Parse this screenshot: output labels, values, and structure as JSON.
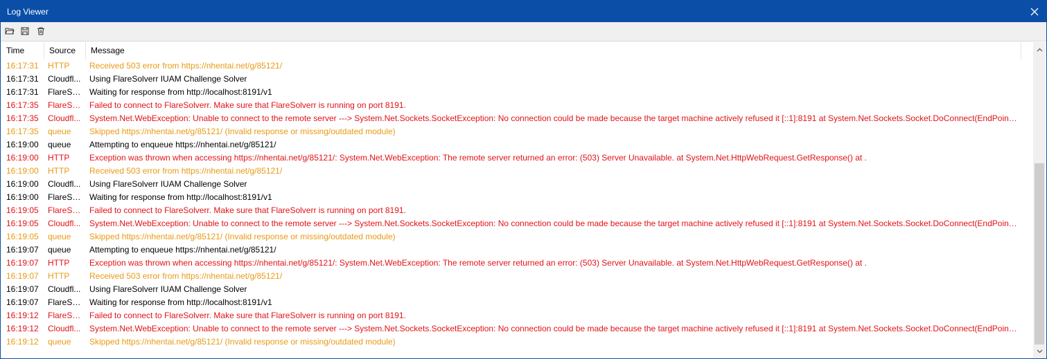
{
  "window": {
    "title": "Log Viewer",
    "close_icon": "close-icon",
    "titlebar_color": "#0a4ea8"
  },
  "toolbar": {
    "buttons": [
      {
        "icon": "folder-open-icon"
      },
      {
        "icon": "save-icon"
      },
      {
        "icon": "trash-icon"
      }
    ]
  },
  "columns": {
    "time": "Time",
    "source": "Source",
    "message": "Message"
  },
  "level_colors": {
    "warn": "#e89a14",
    "info": "#000000",
    "error": "#e11218"
  },
  "rows": [
    {
      "time": "16:17:31",
      "source": "HTTP",
      "message": "Received 503 error from https://nhentai.net/g/85121/",
      "level": "warn"
    },
    {
      "time": "16:17:31",
      "source": "Cloudfl...",
      "message": "Using FlareSolverr IUAM Challenge Solver",
      "level": "info"
    },
    {
      "time": "16:17:31",
      "source": "FlareSo...",
      "message": "Waiting for response from http://localhost:8191/v1",
      "level": "info"
    },
    {
      "time": "16:17:35",
      "source": "FlareSo...",
      "message": "Failed to connect to FlareSolverr. Make sure that FlareSolverr is running on port 8191.",
      "level": "error"
    },
    {
      "time": "16:17:35",
      "source": "Cloudfl...",
      "message": "System.Net.WebException: Unable to connect to the remote server ---> System.Net.Sockets.SocketException: No connection could be made because the target machine actively refused it [::1]:8191    at System.Net.Sockets.Socket.DoConnect(EndPoint en...",
      "level": "error"
    },
    {
      "time": "16:17:35",
      "source": "queue",
      "message": "Skipped https://nhentai.net/g/85121/ (Invalid response or missing/outdated module)",
      "level": "warn"
    },
    {
      "time": "16:19:00",
      "source": "queue",
      "message": "Attempting to enqueue https://nhentai.net/g/85121/",
      "level": "info"
    },
    {
      "time": "16:19:00",
      "source": "HTTP",
      "message": "Exception was thrown when accessing https://nhentai.net/g/85121/: System.Net.WebException: The remote server returned an error: (503) Server Unavailable.    at System.Net.HttpWebRequest.GetResponse()    at .",
      "level": "error"
    },
    {
      "time": "16:19:00",
      "source": "HTTP",
      "message": "Received 503 error from https://nhentai.net/g/85121/",
      "level": "warn"
    },
    {
      "time": "16:19:00",
      "source": "Cloudfl...",
      "message": "Using FlareSolverr IUAM Challenge Solver",
      "level": "info"
    },
    {
      "time": "16:19:00",
      "source": "FlareSo...",
      "message": "Waiting for response from http://localhost:8191/v1",
      "level": "info"
    },
    {
      "time": "16:19:05",
      "source": "FlareSo...",
      "message": "Failed to connect to FlareSolverr. Make sure that FlareSolverr is running on port 8191.",
      "level": "error"
    },
    {
      "time": "16:19:05",
      "source": "Cloudfl...",
      "message": "System.Net.WebException: Unable to connect to the remote server ---> System.Net.Sockets.SocketException: No connection could be made because the target machine actively refused it [::1]:8191    at System.Net.Sockets.Socket.DoConnect(EndPoint en...",
      "level": "error"
    },
    {
      "time": "16:19:05",
      "source": "queue",
      "message": "Skipped https://nhentai.net/g/85121/ (Invalid response or missing/outdated module)",
      "level": "warn"
    },
    {
      "time": "16:19:07",
      "source": "queue",
      "message": "Attempting to enqueue https://nhentai.net/g/85121/",
      "level": "info"
    },
    {
      "time": "16:19:07",
      "source": "HTTP",
      "message": "Exception was thrown when accessing https://nhentai.net/g/85121/: System.Net.WebException: The remote server returned an error: (503) Server Unavailable.    at System.Net.HttpWebRequest.GetResponse()    at .",
      "level": "error"
    },
    {
      "time": "16:19:07",
      "source": "HTTP",
      "message": "Received 503 error from https://nhentai.net/g/85121/",
      "level": "warn"
    },
    {
      "time": "16:19:07",
      "source": "Cloudfl...",
      "message": "Using FlareSolverr IUAM Challenge Solver",
      "level": "info"
    },
    {
      "time": "16:19:07",
      "source": "FlareSo...",
      "message": "Waiting for response from http://localhost:8191/v1",
      "level": "info"
    },
    {
      "time": "16:19:12",
      "source": "FlareSo...",
      "message": "Failed to connect to FlareSolverr. Make sure that FlareSolverr is running on port 8191.",
      "level": "error"
    },
    {
      "time": "16:19:12",
      "source": "Cloudfl...",
      "message": "System.Net.WebException: Unable to connect to the remote server ---> System.Net.Sockets.SocketException: No connection could be made because the target machine actively refused it [::1]:8191    at System.Net.Sockets.Socket.DoConnect(EndPoint en...",
      "level": "error"
    },
    {
      "time": "16:19:12",
      "source": "queue",
      "message": "Skipped https://nhentai.net/g/85121/ (Invalid response or missing/outdated module)",
      "level": "warn"
    }
  ],
  "scrollbar": {
    "up_icon": "scroll-up-arrow-icon",
    "down_icon": "scroll-down-arrow-icon"
  }
}
